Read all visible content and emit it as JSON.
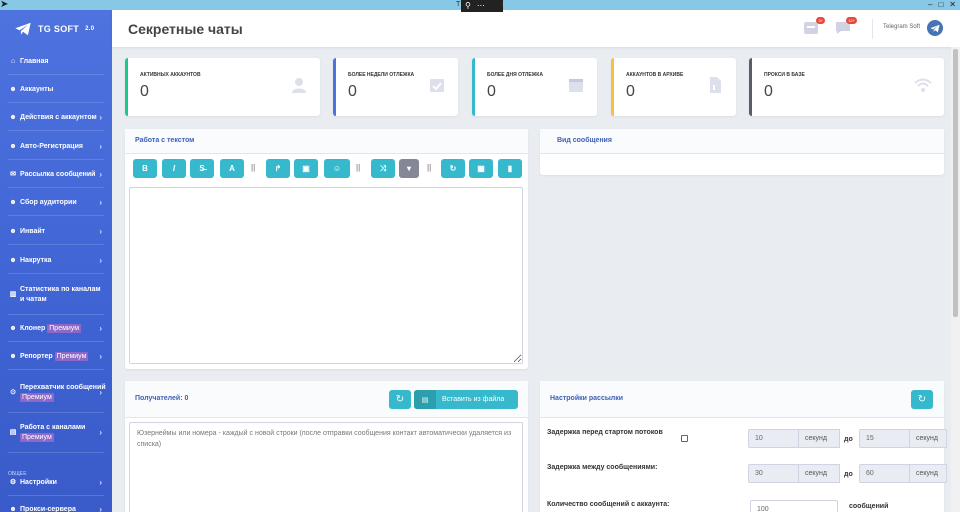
{
  "window": {
    "title_fragment": "T",
    "title_suffix": "t",
    "zoom_glyph": "⚲",
    "menu_glyph": "⋯"
  },
  "sidebar": {
    "brand": "TG SOFT",
    "brand_version": "2.0",
    "section_label": "ОБЩЕЕ",
    "items": [
      {
        "label": "Главная",
        "icon": "home-icon",
        "glyph": "⌂"
      },
      {
        "label": "Аккаунты",
        "icon": "users-icon",
        "glyph": "☻"
      },
      {
        "label": "Действия с аккаунтом",
        "icon": "user-action-icon",
        "glyph": "☻"
      },
      {
        "label": "Авто-Регистрация",
        "icon": "user-plus-icon",
        "glyph": "☻"
      },
      {
        "label": "Рассылка сообщений",
        "icon": "envelope-icon",
        "glyph": "✉"
      },
      {
        "label": "Сбор аудитории",
        "icon": "users-group-icon",
        "glyph": "☻"
      },
      {
        "label": "Инвайт",
        "icon": "invite-icon",
        "glyph": "☻"
      },
      {
        "label": "Накрутка",
        "icon": "boost-icon",
        "glyph": "☻"
      },
      {
        "label": "Статистика по каналам и чатам",
        "icon": "chart-icon",
        "glyph": "▥"
      },
      {
        "label": "Клонер",
        "premium": "Премиум",
        "icon": "clone-icon",
        "glyph": "☻"
      },
      {
        "label": "Репортер",
        "premium": "Премиум",
        "icon": "report-icon",
        "glyph": "☻"
      },
      {
        "label": "Перехватчик сообщений",
        "premium": "Премиум",
        "icon": "intercept-icon",
        "glyph": "⊙"
      },
      {
        "label": "Работа с каналами",
        "premium": "Премиум",
        "icon": "channel-icon",
        "glyph": "▤"
      },
      {
        "label": "Настройки",
        "icon": "gear-icon",
        "glyph": "⚙"
      },
      {
        "label": "Прокси-сервера",
        "icon": "proxy-icon",
        "glyph": "☻"
      }
    ]
  },
  "topbar": {
    "title": "Секретные чаты",
    "badge_1": "3+",
    "badge_2": "12+",
    "user_name": "Telegram Soft"
  },
  "stats": [
    {
      "label": "АКТИВНЫХ АККАУНТОВ",
      "value": "0",
      "color": "#1cc88a",
      "icon": "user-icon"
    },
    {
      "label": "БОЛЕЕ НЕДЕЛИ ОТЛЕЖКА",
      "value": "0",
      "color": "#4e73df",
      "icon": "calendar-check-icon"
    },
    {
      "label": "БОЛЕЕ ДНЯ ОТЛЕЖКА",
      "value": "0",
      "color": "#36b9cc",
      "icon": "calendar-icon"
    },
    {
      "label": "АККАУНТОВ В АРХИВЕ",
      "value": "0",
      "color": "#f6c23e",
      "icon": "file-icon"
    },
    {
      "label": "ПРОКСИ В БАЗЕ",
      "value": "0",
      "color": "#5a5c69",
      "icon": "wifi-icon"
    }
  ],
  "text_panel": {
    "title": "Работа с текстом",
    "separator": "||",
    "buttons": [
      {
        "name": "bold-button",
        "icon": "bold-icon",
        "glyph": "B"
      },
      {
        "name": "italic-button",
        "icon": "italic-icon",
        "glyph": "I"
      },
      {
        "name": "strikethrough-button",
        "icon": "strikethrough-icon",
        "glyph": "S̶"
      },
      {
        "name": "font-button",
        "icon": "font-icon",
        "glyph": "A"
      },
      {
        "name": "share-button",
        "icon": "share-icon",
        "glyph": "↱"
      },
      {
        "name": "image-button",
        "icon": "image-icon",
        "glyph": "▣"
      },
      {
        "name": "emoji-button",
        "icon": "emoji-icon",
        "glyph": "☺"
      },
      {
        "name": "shuffle-button",
        "icon": "shuffle-icon",
        "glyph": "⤨"
      },
      {
        "name": "dropdown-button",
        "icon": "caret-down-icon",
        "glyph": "▾"
      },
      {
        "name": "reset-button",
        "icon": "redo-icon",
        "glyph": "↻"
      },
      {
        "name": "save-button",
        "icon": "save-icon",
        "glyph": "▦"
      },
      {
        "name": "delete-button",
        "icon": "trash-icon",
        "glyph": "▮"
      }
    ]
  },
  "preview_panel": {
    "title": "Вид сообщения"
  },
  "recipients_panel": {
    "title": "Получателей: 0",
    "refresh_glyph": "↻",
    "file_glyph": "▤",
    "paste_label": "Вставить из файла",
    "placeholder": "Юзернеймы или номера - каждый с новой строки (после отправки сообщения контакт автоматически удаляется из списка)"
  },
  "settings_panel": {
    "title": "Настройки рассылки",
    "refresh_glyph": "↻",
    "rows": [
      {
        "label": "Задержка перед стартом потоков",
        "from": "10",
        "to": "15",
        "unit": "секунд",
        "between": "до"
      },
      {
        "label": "Задержка между сообщениями:",
        "from": "30",
        "to": "60",
        "unit": "секунд",
        "between": "до"
      },
      {
        "label": "Количество сообщений с аккаунта:",
        "from": "100",
        "unit": "сообщений"
      }
    ]
  }
}
